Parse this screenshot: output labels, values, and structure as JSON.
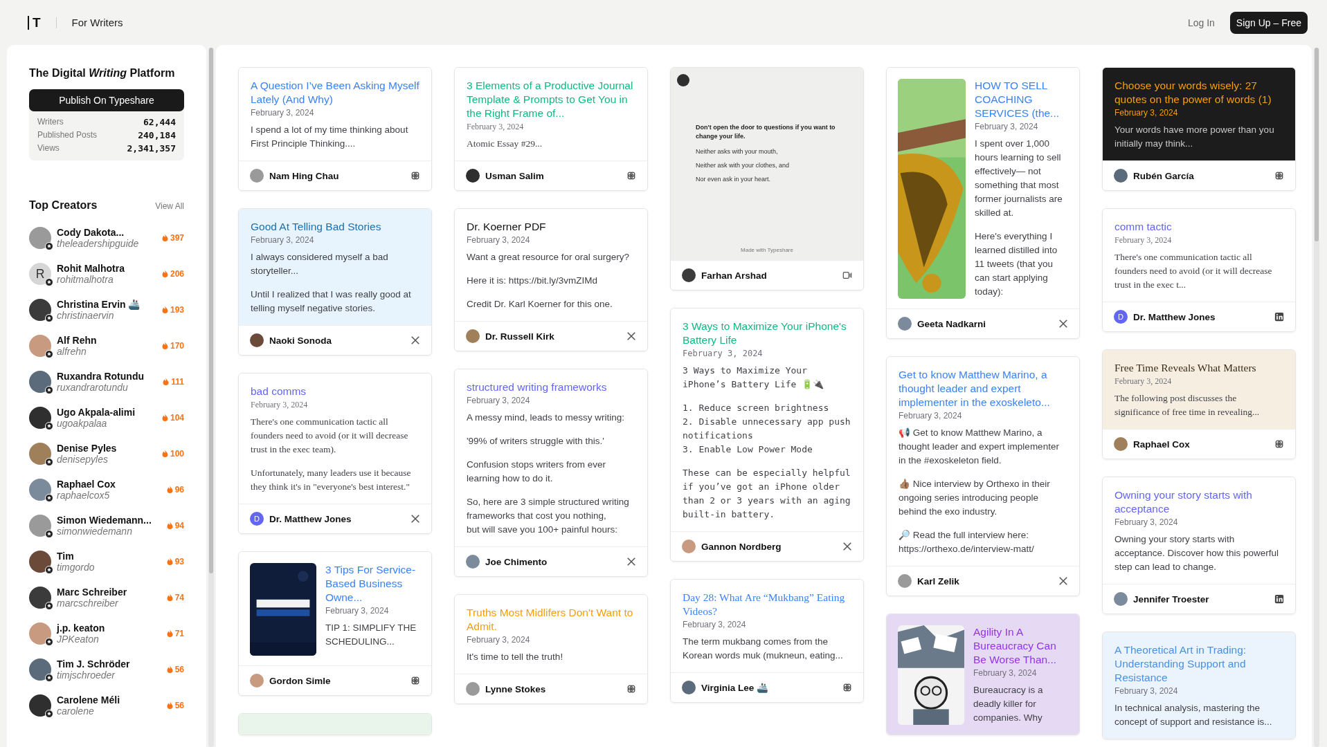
{
  "header": {
    "logo": "T",
    "section": "For Writers",
    "login": "Log In",
    "signup": "Sign Up – Free"
  },
  "sidebar": {
    "title": "The Digital *Writing* Platform",
    "publish": "Publish On Typeshare",
    "stats": [
      {
        "label": "Writers",
        "value": "62,444"
      },
      {
        "label": "Published Posts",
        "value": "240,184"
      },
      {
        "label": "Views",
        "value": "2,341,357"
      }
    ],
    "creators_title": "Top Creators",
    "view_all": "View All",
    "creators": [
      {
        "name": "Cody Dakota...",
        "handle": "theleadershipguide",
        "score": "397"
      },
      {
        "name": "Rohit Malhotra",
        "handle": "rohitmalhotra",
        "score": "206",
        "initial": "R",
        "color": "#d6d6d6"
      },
      {
        "name": "Christina Ervin 🚢",
        "handle": "christinaervin",
        "score": "193"
      },
      {
        "name": "Alf Rehn",
        "handle": "alfrehn",
        "score": "170"
      },
      {
        "name": "Ruxandra Rotundu",
        "handle": "ruxandrarotundu",
        "score": "111"
      },
      {
        "name": "Ugo Akpala-alimi",
        "handle": "ugoakpalaa",
        "score": "104"
      },
      {
        "name": "Denise Pyles",
        "handle": "denisepyles",
        "score": "100"
      },
      {
        "name": "Raphael Cox",
        "handle": "raphaelcox5",
        "score": "96"
      },
      {
        "name": "Simon Wiedemann...",
        "handle": "simonwiedemann",
        "score": "94"
      },
      {
        "name": "Tim",
        "handle": "timgordo",
        "score": "93"
      },
      {
        "name": "Marc Schreiber",
        "handle": "marcschreiber",
        "score": "74"
      },
      {
        "name": "j.p. keaton",
        "handle": "JPKeaton",
        "score": "71"
      },
      {
        "name": "Tim J. Schröder",
        "handle": "timjschroeder",
        "score": "56"
      },
      {
        "name": "Carolene Méli",
        "handle": "carolene",
        "score": "56"
      }
    ]
  },
  "columns": [
    [
      {
        "kind": "text",
        "color": "#ffffff",
        "serif": false,
        "title": {
          "text": "A Question I’ve Been Asking Myself Lately (And Why)",
          "color": "#3b82f6"
        },
        "date": "February 3, 2024",
        "paragraphs": [
          "I spend a lot of my time thinking about First Principle Thinking...."
        ],
        "author": {
          "name": "Nam Hing Chau"
        },
        "source": {
          "kind": "typeshare"
        }
      },
      {
        "kind": "text",
        "color": "#e8f4fd",
        "serif": false,
        "title": {
          "text": "Good At Telling Bad Stories",
          "color": "#1d6fb0"
        },
        "date": "February 3, 2024",
        "paragraphs": [
          "I always considered myself a bad storyteller...",
          "Until I realized that I was really good at telling myself negative stories."
        ],
        "author": {
          "name": "Naoki Sonoda"
        },
        "source": {
          "kind": "x"
        }
      },
      {
        "kind": "text",
        "color": "#ffffff",
        "serif": true,
        "title": {
          "text": "bad comms",
          "color": "#6366f1"
        },
        "date": "February 3, 2024",
        "paragraphs": [
          "There's one communication tactic all founders need to avoid (or it will decrease trust in the exec team).",
          "Unfortunately, many leaders use it because they think it's in \"everyone's best interest.\""
        ],
        "author": {
          "name": "Dr. Matthew Jones",
          "initial": "D",
          "color": "#6366f1"
        },
        "source": {
          "kind": "x"
        }
      },
      {
        "color": "#ffffff",
        "thumb": {
          "kind": "picture"
        },
        "title": {
          "text": "3 Tips For Service-Based Business Owne...",
          "color": "#3b82f6"
        },
        "date": "February 3, 2024",
        "paragraphs": [
          "TIP 1: SIMPLIFY THE SCHEDULING..."
        ],
        "author": {
          "name": "Gordon Simle"
        },
        "source": {
          "kind": "typeshare"
        }
      },
      {
        "kind": "stub",
        "color": "#e9f5ea"
      }
    ],
    [
      {
        "kind": "text",
        "color": "#ffffff",
        "serif": true,
        "title": {
          "text": "3 Elements of a Productive Journal Template & Prompts to Get You in the Right Frame of...",
          "color": "#10b981"
        },
        "date": "February 3, 2024",
        "paragraphs": [
          "Atomic Essay #29..."
        ],
        "author": {
          "name": "Usman Salim"
        },
        "source": {
          "kind": "typeshare"
        }
      },
      {
        "kind": "text",
        "color": "#ffffff",
        "serif": false,
        "title": {
          "text": "Dr. Koerner PDF",
          "color": "#111111"
        },
        "date": "February 3, 2024",
        "paragraphs": [
          "Want a great resource for oral surgery?",
          "Here it is: https://bit.ly/3vmZIMd",
          "Credit Dr. Karl Koerner for this one."
        ],
        "author": {
          "name": "Dr. Russell Kirk"
        },
        "source": {
          "kind": "x"
        }
      },
      {
        "kind": "text",
        "color": "#ffffff",
        "serif": false,
        "title": {
          "text": "structured writing frameworks",
          "color": "#6366f1"
        },
        "date": "February 3, 2024",
        "paragraphs": [
          "A messy mind, leads to messy writing:",
          "'99% of writers struggle with this.'",
          "Confusion stops writers from ever learning how to do it.",
          "So, here are 3 simple structured writing frameworks that cost you nothing,\nbut will save you 100+ painful hours:"
        ],
        "author": {
          "name": "Joe Chimento"
        },
        "source": {
          "kind": "x"
        }
      },
      {
        "kind": "text",
        "color": "#ffffff",
        "serif": false,
        "title": {
          "text": "Truths Most Midlifers Don't Want to Admit.",
          "color": "#f59e0b"
        },
        "date": "February 3, 2024",
        "paragraphs": [
          "It's time to tell the truth!"
        ],
        "author": {
          "name": "Lynne Stokes"
        },
        "source": {
          "kind": "typeshare"
        }
      }
    ],
    [
      {
        "kind": "quote",
        "lead": "Don't open the door to questions if you want to change your life.",
        "lines": [
          "Neither asks with your mouth,",
          "Neither ask with your clothes, and",
          "Nor even ask in your heart."
        ],
        "credit": "Made with Typeshare",
        "author": {
          "name": "Farhan Arshad"
        },
        "source": {
          "kind": "video"
        }
      },
      {
        "kind": "text",
        "color": "#ffffff",
        "mono": true,
        "title": {
          "text": "3 Ways to Maximize Your iPhone's Battery Life",
          "color": "#10b981"
        },
        "date": "February 3, 2024",
        "paragraphs": [
          "3 Ways to Maximize Your iPhone’s Battery Life 🔋🔌",
          "1. Reduce screen brightness\n2. Disable unnecessary app push notifications\n3. Enable Low Power Mode",
          "These can be especially helpful if you’ve got an iPhone older than 2 or 3 years with an aging built-in battery."
        ],
        "author": {
          "name": "Gannon Nordberg"
        },
        "source": {
          "kind": "x"
        }
      },
      {
        "kind": "text",
        "color": "#ffffff",
        "serif": false,
        "title": {
          "text": "Day 28: What Are “Mukbang” Eating Videos?",
          "color": "#3b82f6",
          "serif": true
        },
        "date": "February 3, 2024",
        "paragraphs": [
          "The term mukbang comes from the Korean words muk (mukneun, eating..."
        ],
        "author": {
          "name": "Virginia Lee 🚢"
        },
        "source": {
          "kind": "typeshare"
        }
      }
    ],
    [
      {
        "color": "#ffffff",
        "thumb": {
          "kind": "picture"
        },
        "title": {
          "text": "HOW TO SELL COACHING SERVICES (the...",
          "color": "#3b82f6"
        },
        "date": "February 3, 2024",
        "paragraphs": [
          "I spent over 1,000 hours learning to sell effectively— not something that most former journalists are skilled at.",
          "Here's everything I learned distilled into 11 tweets (that you can start applying today):"
        ],
        "author": {
          "name": "Geeta Nadkarni"
        },
        "source": {
          "kind": "x"
        }
      },
      {
        "kind": "text",
        "color": "#ffffff",
        "serif": false,
        "title": {
          "text": "Get to know Matthew Marino, a thought leader and expert implementer in the exoskeleto...",
          "color": "#3b82f6"
        },
        "date": "February 3, 2024",
        "paragraphs": [
          "📢 Get to know Matthew Marino, a thought leader and expert implementer in the #exoskeleton field.",
          "👍🏽 Nice interview by Orthexo in their ongoing series introducing people behind the exo industry.",
          "🔎 Read the full interview here: https://orthexo.de/interview-matt/"
        ],
        "author": {
          "name": "Karl Zelik"
        },
        "source": {
          "kind": "x"
        }
      },
      {
        "color": "#e6d9f3",
        "thumb": {
          "kind": "picture"
        },
        "title": {
          "text": "Agility In A Bureaucracy Can Be Worse Than...",
          "color": "#9333ea"
        },
        "date": "February 3, 2024",
        "paragraphs": [
          "Bureaucracy is a deadly killer for companies. Why"
        ]
      }
    ],
    [
      {
        "kind": "text",
        "color": "#1c1c1c",
        "dark": true,
        "serif": false,
        "title": {
          "text": "Choose your words wisely: 27 quotes on the power of words (1)",
          "color": "#f59e0b"
        },
        "date": "February 3, 2024",
        "paragraphs": [
          "Your words have more power than you initially may think..."
        ],
        "author": {
          "name": "Rubén García"
        },
        "source": {
          "kind": "typeshare"
        }
      },
      {
        "kind": "text",
        "color": "#ffffff",
        "serif": true,
        "title": {
          "text": "comm tactic",
          "color": "#6366f1"
        },
        "date": "February 3, 2024",
        "paragraphs": [
          "There's one communication tactic all founders need to avoid (or it will decrease trust in the exec t..."
        ],
        "author": {
          "name": "Dr. Matthew Jones",
          "initial": "D",
          "color": "#6366f1"
        },
        "source": {
          "kind": "linkedin"
        }
      },
      {
        "kind": "text",
        "color": "#f6eee1",
        "serif": true,
        "title": {
          "text": "Free Time Reveals What Matters",
          "color": "#3b2a1a",
          "serif": true
        },
        "date": "February 3, 2024",
        "paragraphs": [
          "The following post discusses the significance of free time in revealing..."
        ],
        "author": {
          "name": "Raphael Cox"
        },
        "source": {
          "kind": "typeshare"
        }
      },
      {
        "kind": "text",
        "color": "#ffffff",
        "serif": false,
        "title": {
          "text": "Owning your story starts with acceptance",
          "color": "#6366f1"
        },
        "date": "February 3, 2024",
        "paragraphs": [
          "Owning your story starts with acceptance. Discover how this powerful step can lead to change."
        ],
        "author": {
          "name": "Jennifer Troester"
        },
        "source": {
          "kind": "linkedin"
        }
      },
      {
        "kind": "text",
        "color": "#ebf3fd",
        "serif": false,
        "title": {
          "text": "A Theoretical Art in Trading: Understanding Support and Resistance",
          "color": "#4a90e2"
        },
        "date": "February 3, 2024",
        "paragraphs": [
          "In technical analysis, mastering the concept of support and resistance is..."
        ]
      }
    ]
  ]
}
